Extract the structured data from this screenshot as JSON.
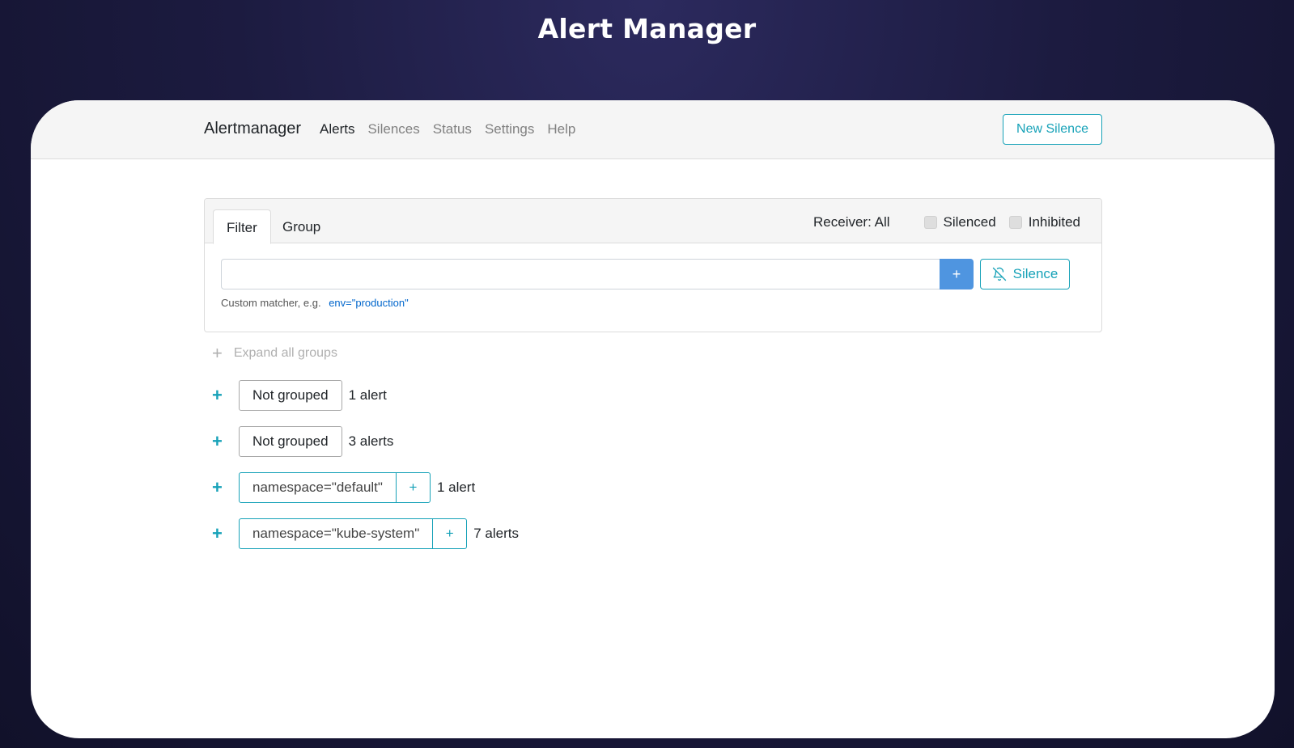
{
  "page": {
    "title": "Alert Manager"
  },
  "navbar": {
    "brand": "Alertmanager",
    "links": [
      "Alerts",
      "Silences",
      "Status",
      "Settings",
      "Help"
    ],
    "new_silence": "New Silence"
  },
  "filter_card": {
    "tabs": [
      "Filter",
      "Group"
    ],
    "receiver": "Receiver: All",
    "silenced_label": "Silenced",
    "inhibited_label": "Inhibited",
    "input_value": "",
    "add_button": "+",
    "silence_button": "Silence",
    "help_text": "Custom matcher, e.g.",
    "help_example": "env=\"production\""
  },
  "groups": {
    "expand_all": "Expand all groups",
    "items": [
      {
        "label": "Not grouped",
        "count": "1 alert"
      },
      {
        "label": "Not grouped",
        "count": "3 alerts"
      },
      {
        "label": "namespace=\"default\"",
        "count": "1 alert",
        "add": "+"
      },
      {
        "label": "namespace=\"kube-system\"",
        "count": "7 alerts",
        "add": "+"
      }
    ]
  },
  "colors": {
    "accent": "#17a2b8",
    "primary": "#4f95e0",
    "link": "#0066cc"
  }
}
